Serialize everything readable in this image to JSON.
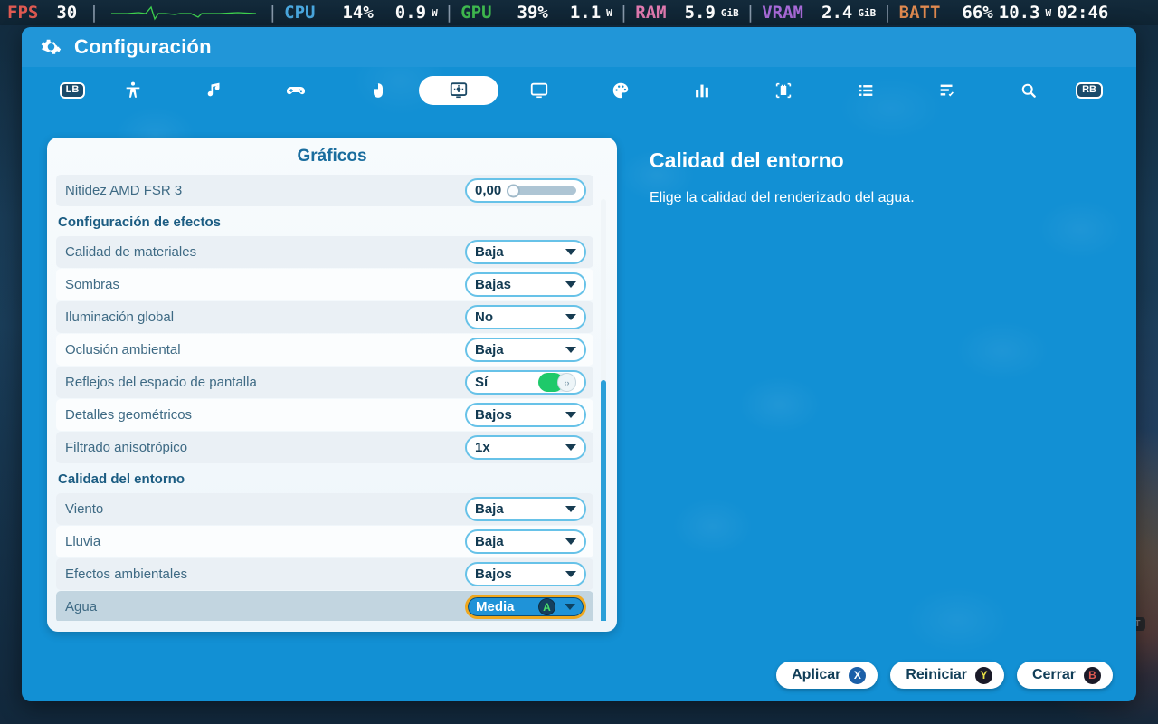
{
  "hud": {
    "fps_label": "FPS",
    "fps_value": "30",
    "cpu_label": "CPU",
    "cpu_usage": "14%",
    "cpu_power": "0.9",
    "cpu_power_unit": "W",
    "gpu_label": "GPU",
    "gpu_usage": "39%",
    "gpu_power": "1.1",
    "gpu_power_unit": "W",
    "ram_label": "RAM",
    "ram_value": "5.9",
    "ram_unit": "GiB",
    "vram_label": "VRAM",
    "vram_value": "2.4",
    "vram_unit": "GiB",
    "batt_label": "BATT",
    "batt_percent": "66%",
    "batt_power": "10.3",
    "batt_power_unit": "W",
    "batt_time": "02:46",
    "colors": {
      "fps": "#e05a52",
      "cpu": "#4aa8e0",
      "gpu": "#3fb94f",
      "ram": "#e07ab0",
      "vram": "#a86ad8",
      "batt": "#e08a50",
      "graph": "#3fd44f"
    }
  },
  "window": {
    "title": "Configuración",
    "gear_icon": "gear-icon"
  },
  "tabs": [
    {
      "id": "lb-hint",
      "icon": "lb-bumper-icon",
      "label": "LB",
      "active": false,
      "type": "badge"
    },
    {
      "id": "accessibility",
      "icon": "accessibility-icon",
      "active": false
    },
    {
      "id": "audio",
      "icon": "music-note-icon",
      "active": false
    },
    {
      "id": "controller",
      "icon": "gamepad-icon",
      "active": false
    },
    {
      "id": "mouse",
      "icon": "mouse-icon",
      "active": false
    },
    {
      "id": "graphics",
      "icon": "monitor-settings-icon",
      "active": true
    },
    {
      "id": "display",
      "icon": "display-icon",
      "active": false
    },
    {
      "id": "appearance",
      "icon": "palette-icon",
      "active": false
    },
    {
      "id": "performance",
      "icon": "bar-chart-icon",
      "active": false
    },
    {
      "id": "hardware",
      "icon": "chip-icon",
      "active": false
    },
    {
      "id": "list",
      "icon": "list-icon",
      "active": false
    },
    {
      "id": "tasks",
      "icon": "checklist-icon",
      "active": false
    },
    {
      "id": "search",
      "icon": "search-icon",
      "active": false
    },
    {
      "id": "rb-hint",
      "icon": "rb-bumper-icon",
      "label": "RB",
      "active": false,
      "type": "badge"
    }
  ],
  "list": {
    "title": "Gráficos",
    "rows": [
      {
        "kind": "setting",
        "label": "Nitidez AMD FSR 3",
        "control": "slider",
        "value": "0,00",
        "slider_percent": 0
      },
      {
        "kind": "header",
        "label": "Configuración de efectos"
      },
      {
        "kind": "setting",
        "label": "Calidad de materiales",
        "control": "dropdown",
        "value": "Baja"
      },
      {
        "kind": "setting",
        "label": "Sombras",
        "control": "dropdown",
        "value": "Bajas"
      },
      {
        "kind": "setting",
        "label": "Iluminación global",
        "control": "dropdown",
        "value": "No"
      },
      {
        "kind": "setting",
        "label": "Oclusión ambiental",
        "control": "dropdown",
        "value": "Baja"
      },
      {
        "kind": "setting",
        "label": "Reflejos del espacio de pantalla",
        "control": "toggle",
        "value": "Sí",
        "on": true
      },
      {
        "kind": "setting",
        "label": "Detalles geométricos",
        "control": "dropdown",
        "value": "Bajos"
      },
      {
        "kind": "setting",
        "label": "Filtrado anisotrópico",
        "control": "dropdown",
        "value": "1x"
      },
      {
        "kind": "header",
        "label": "Calidad del entorno"
      },
      {
        "kind": "setting",
        "label": "Viento",
        "control": "dropdown",
        "value": "Baja"
      },
      {
        "kind": "setting",
        "label": "Lluvia",
        "control": "dropdown",
        "value": "Baja"
      },
      {
        "kind": "setting",
        "label": "Efectos ambientales",
        "control": "dropdown",
        "value": "Bajos"
      },
      {
        "kind": "setting",
        "label": "Agua",
        "control": "dropdown",
        "value": "Media",
        "selected": true,
        "button_hint": "A"
      }
    ]
  },
  "description": {
    "title": "Calidad del entorno",
    "text": "Elige la calidad del renderizado del agua."
  },
  "footer": {
    "buttons": [
      {
        "label": "Aplicar",
        "hint": "X",
        "hint_style": "gb-x"
      },
      {
        "label": "Reiniciar",
        "hint": "Y",
        "hint_style": "gb-y"
      },
      {
        "label": "Cerrar",
        "hint": "B",
        "hint_style": "gb-b"
      }
    ]
  },
  "background": {
    "chip_label": "RT"
  },
  "colors": {
    "accent_blue": "#1290d4",
    "title_blue": "#2196d8",
    "focus_gold": "#f0a81e",
    "toggle_green": "#1ec96a",
    "card_bg": "#f7fbfd"
  }
}
